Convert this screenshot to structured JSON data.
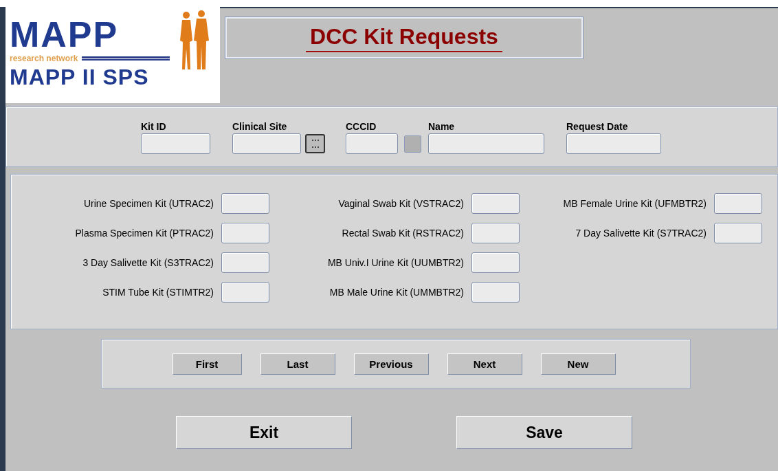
{
  "logo": {
    "main": "MAPP",
    "tagline": "research network",
    "subtitle": "MAPP II SPS"
  },
  "title": "DCC Kit Requests",
  "search_fields": [
    {
      "label": "Kit ID",
      "kind": "plain"
    },
    {
      "label": "Clinical Site",
      "kind": "lookup"
    },
    {
      "label": "CCCID",
      "kind": "toggle"
    },
    {
      "label": "Name",
      "kind": "plain"
    },
    {
      "label": "Request Date",
      "kind": "plain"
    }
  ],
  "kit_columns": [
    [
      {
        "label": "Urine Specimen Kit (UTRAC2)"
      },
      {
        "label": "Plasma Specimen Kit (PTRAC2)"
      },
      {
        "label": "3 Day Salivette Kit (S3TRAC2)"
      },
      {
        "label": "STIM Tube Kit (STIMTR2)"
      }
    ],
    [
      {
        "label": "Vaginal Swab Kit (VSTRAC2)"
      },
      {
        "label": "Rectal Swab Kit (RSTRAC2)"
      },
      {
        "label": "MB Univ.I Urine Kit (UUMBTR2)"
      },
      {
        "label": "MB Male Urine Kit (UMMBTR2)"
      }
    ],
    [
      {
        "label": "MB Female Urine Kit (UFMBTR2)"
      },
      {
        "label": "7 Day Salivette Kit (S7TRAC2)"
      }
    ]
  ],
  "nav_buttons": [
    "First",
    "Last",
    "Previous",
    "Next",
    "New"
  ],
  "action_buttons": [
    "Exit",
    "Save"
  ]
}
